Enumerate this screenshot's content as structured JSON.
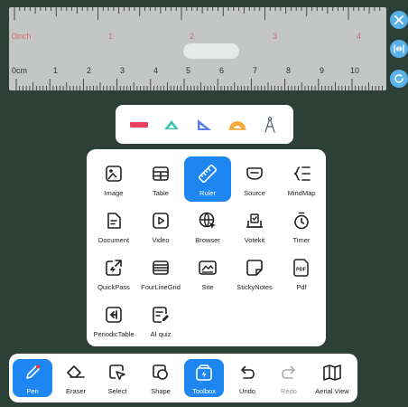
{
  "ruler": {
    "inch_label": "0inch",
    "inch_marks": [
      "1",
      "2",
      "3",
      "4"
    ],
    "cm_label": "0cm",
    "cm_marks": [
      "1",
      "2",
      "3",
      "4",
      "5",
      "6",
      "7",
      "8",
      "9",
      "10"
    ],
    "side_controls": [
      "close-icon",
      "width-adjust-icon",
      "rotate-icon"
    ]
  },
  "ruler_types": [
    "straight-ruler",
    "triangle-45",
    "triangle-30-60",
    "protractor",
    "compass"
  ],
  "toolbox": {
    "items": [
      {
        "label": "Image",
        "icon": "image-icon"
      },
      {
        "label": "Table",
        "icon": "table-icon"
      },
      {
        "label": "Ruler",
        "icon": "ruler-icon",
        "active": true
      },
      {
        "label": "Source",
        "icon": "source-icon"
      },
      {
        "label": "MindMap",
        "icon": "mindmap-icon"
      },
      {
        "label": "Document",
        "icon": "document-icon"
      },
      {
        "label": "Video",
        "icon": "video-icon"
      },
      {
        "label": "Browser",
        "icon": "browser-icon"
      },
      {
        "label": "Votekit",
        "icon": "votekit-icon"
      },
      {
        "label": "Timer",
        "icon": "timer-icon"
      },
      {
        "label": "QuickPass",
        "icon": "quickpass-icon"
      },
      {
        "label": "FourLineGrid",
        "icon": "four-line-grid-icon"
      },
      {
        "label": "Site",
        "icon": "site-icon"
      },
      {
        "label": "StickyNotes",
        "icon": "sticky-notes-icon"
      },
      {
        "label": "Pdf",
        "icon": "pdf-icon"
      },
      {
        "label": "PeriodicTable",
        "icon": "periodic-table-icon"
      },
      {
        "label": "AI quiz",
        "icon": "ai-quiz-icon"
      }
    ]
  },
  "bottom_bar": {
    "items": [
      {
        "label": "Pen",
        "icon": "pen-icon",
        "active": true
      },
      {
        "label": "Eraser",
        "icon": "eraser-icon"
      },
      {
        "label": "Select",
        "icon": "select-icon"
      },
      {
        "label": "Shape",
        "icon": "shape-icon"
      },
      {
        "label": "Toolbox",
        "icon": "toolbox-icon",
        "active": true
      },
      {
        "label": "Undo",
        "icon": "undo-icon"
      },
      {
        "label": "Redo",
        "icon": "redo-icon",
        "disabled": true
      },
      {
        "label": "Aerial View",
        "icon": "aerial-view-icon"
      }
    ]
  },
  "colors": {
    "board": "#2d4037",
    "accent": "#1d86f0",
    "ruler": "#c4c6c6",
    "inch_marks": "#cf6c6c",
    "side_control": "#5ab2ea"
  }
}
